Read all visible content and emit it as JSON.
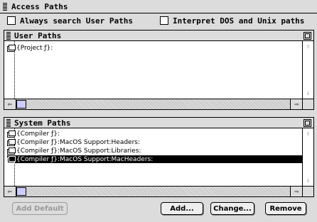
{
  "window": {
    "title": "Access Paths"
  },
  "options": {
    "always_search_label": "Always search User Paths",
    "interpret_label": "Interpret DOS and Unix paths"
  },
  "user_paths": {
    "title": "User Paths",
    "items": [
      "{Project ƒ}:"
    ]
  },
  "system_paths": {
    "title": "System Paths",
    "items": [
      "{Compiler ƒ}:",
      "{Compiler ƒ}:MacOS Support:Headers:",
      "{Compiler ƒ}:MacOS Support:Libraries:",
      "{Compiler ƒ}:MacOS Support:MacHeaders:"
    ],
    "selected_index": 3
  },
  "buttons": {
    "add_default": "Add Default",
    "add": "Add...",
    "change": "Change...",
    "remove": "Remove"
  },
  "icons": {
    "folder": "folder-icon",
    "up_arrow": "up-arrow-icon",
    "down_arrow": "down-arrow-icon",
    "left_arrow": "left-arrow-icon",
    "right_arrow": "right-arrow-icon",
    "zoom": "zoom-box-icon"
  }
}
